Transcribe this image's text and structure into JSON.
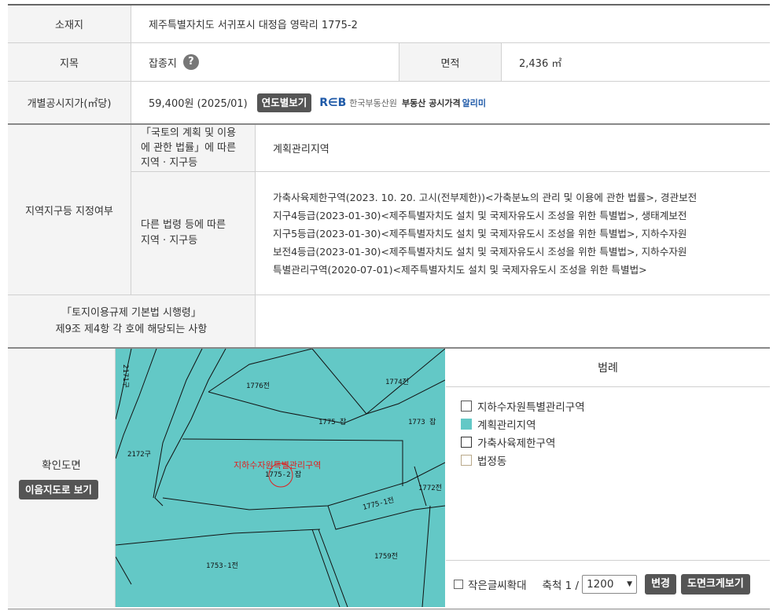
{
  "location": {
    "label": "소재지",
    "value": "제주특별자치도 서귀포시 대정읍 영락리 1775-2"
  },
  "land": {
    "category_label": "지목",
    "category_value": "잡종지",
    "help_icon": "?",
    "area_label": "면적",
    "area_value": "2,436 ㎡"
  },
  "price": {
    "label": "개별공시지가(㎡당)",
    "value": "59,400원 (2025/01)",
    "button": "연도별보기",
    "reb_logo": "R∈B",
    "reb_org": "한국부동산원",
    "reb_service": "부동산 공시가격",
    "reb_service2": "알리미"
  },
  "zone": {
    "label": "지역지구등 지정여부",
    "sub1_label_lines": [
      "「국토의 계획 및 이용",
      "에 관한 법률」에 따른",
      "지역 · 지구등"
    ],
    "sub1_value": "계획관리지역",
    "sub2_label_lines": [
      "다른 법령 등에 따른",
      "지역 · 지구등"
    ],
    "sub2_value_lines": [
      "가축사육제한구역(2023. 10. 20. 고시(전부제한))<가축분뇨의 관리 및 이용에 관한 법률>, 경관보전",
      "지구4등급(2023-01-30)<제주특별자치도 설치 및 국제자유도시 조성을 위한 특별법>, 생태계보전",
      "지구5등급(2023-01-30)<제주특별자치도 설치 및 국제자유도시 조성을 위한 특별법>, 지하수자원",
      "보전4등급(2023-01-30)<제주특별자치도 설치 및 국제자유도시 조성을 위한 특별법>, 지하수자원",
      "특별관리구역(2020-07-01)<제주특별자치도 설치 및 국제자유도시 조성을 위한 특별법>"
    ]
  },
  "regulation": {
    "label_lines": [
      "「토지이용규제 기본법 시행령」",
      "제9조 제4항 각 호에 해당되는 사항"
    ],
    "value": ""
  },
  "map": {
    "label": "확인도면",
    "button": "이음지도로 보기",
    "fill_color": "#63c8c6",
    "overlay_text": "지하수자원특별관리구역",
    "parcels": [
      "1776전",
      "1774전",
      "1775 잡",
      "1773 잡",
      "2172구",
      "1775-2 잡",
      "1772전",
      "1775-1전",
      "1753-1전",
      "1759전",
      "2171구"
    ]
  },
  "legend": {
    "title": "범례",
    "items": [
      {
        "label": "지하수자원특별관리구역",
        "color": "#ffffff",
        "border": "#555555"
      },
      {
        "label": "계획관리지역",
        "color": "#63c8c6",
        "border": "#63c8c6"
      },
      {
        "label": "가축사육제한구역",
        "color": "#ffffff",
        "border": "#333333"
      },
      {
        "label": "법정동",
        "color": "#ffffff",
        "border": "#b9a98a"
      }
    ]
  },
  "controls": {
    "enlarge_label": "작은글씨확대",
    "scale_label": "축척 1 /",
    "scale_value": "1200",
    "change_button": "변경",
    "big_map_button": "도면크게보기"
  }
}
